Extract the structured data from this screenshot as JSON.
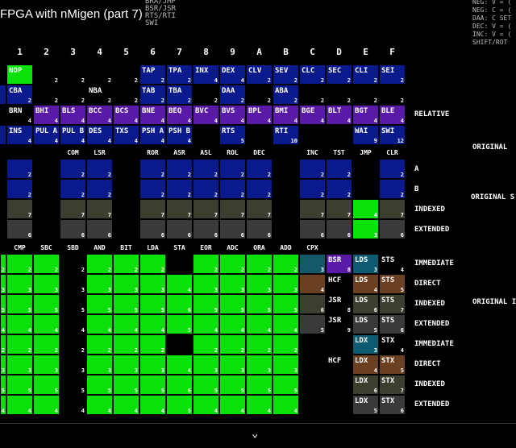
{
  "title": "FPGA with nMigen (part 7)",
  "title_notes": "BRA/JMP\nBSR/JSR\nRTS/RTI\nSWI",
  "side_notes": "NEG: V = (\nNEG: C = (\nDAA: C SET\nDEC: V = (\nINC: V = (\nSHIFT/ROT",
  "col_headers": [
    "1",
    "2",
    "3",
    "4",
    "5",
    "6",
    "7",
    "8",
    "9",
    "A",
    "B",
    "C",
    "D",
    "E",
    "F"
  ],
  "colors": {
    "blue": "#0a1a8c",
    "purple": "#5a1aa8",
    "green": "#0be00b",
    "darkgray": "#1b1b1b",
    "olive": "#3a3f30",
    "gray": "#3a3a3a",
    "teal": "#15586a",
    "brown": "#6a3f22",
    "cyan": "#0e5a70",
    "black": "#000000"
  },
  "top_rows": [
    [
      [
        "",
        "",
        "black"
      ],
      [
        "",
        "2",
        "black"
      ],
      [
        "",
        "2",
        "black"
      ],
      [
        "",
        "2",
        "black"
      ],
      [
        "",
        "2",
        "black"
      ],
      [
        "TAP",
        "2",
        "blue"
      ],
      [
        "TPA",
        "2",
        "blue"
      ],
      [
        "INX",
        "4",
        "blue"
      ],
      [
        "DEX",
        "4",
        "blue"
      ],
      [
        "CLV",
        "2",
        "blue"
      ],
      [
        "SEV",
        "2",
        "blue"
      ],
      [
        "CLC",
        "2",
        "blue"
      ],
      [
        "SEC",
        "2",
        "blue"
      ],
      [
        "CLI",
        "2",
        "blue"
      ],
      [
        "SEI",
        "2",
        "blue"
      ]
    ],
    [
      [
        "CBA",
        "2",
        "blue"
      ],
      [
        "",
        "2",
        "black"
      ],
      [
        "",
        "2",
        "black"
      ],
      [
        "NBA",
        "2",
        "black"
      ],
      [
        "",
        "2",
        "black"
      ],
      [
        "TAB",
        "2",
        "blue"
      ],
      [
        "TBA",
        "2",
        "blue"
      ],
      [
        "",
        "2",
        "black"
      ],
      [
        "DAA",
        "2",
        "blue"
      ],
      [
        "",
        "2",
        "black"
      ],
      [
        "ABA",
        "2",
        "blue"
      ],
      [
        "",
        "2",
        "black"
      ],
      [
        "",
        "2",
        "black"
      ],
      [
        "",
        "2",
        "black"
      ],
      [
        "",
        "2",
        "black"
      ]
    ],
    [
      [
        "BRN",
        "4",
        "black"
      ],
      [
        "BHI",
        "4",
        "purple"
      ],
      [
        "BLS",
        "4",
        "purple"
      ],
      [
        "BCC",
        "4",
        "purple"
      ],
      [
        "BCS",
        "4",
        "purple"
      ],
      [
        "BNE",
        "4",
        "purple"
      ],
      [
        "BEQ",
        "4",
        "purple"
      ],
      [
        "BVC",
        "4",
        "purple"
      ],
      [
        "BVS",
        "4",
        "purple"
      ],
      [
        "BPL",
        "4",
        "purple"
      ],
      [
        "BMI",
        "4",
        "purple"
      ],
      [
        "BGE",
        "4",
        "purple"
      ],
      [
        "BLT",
        "4",
        "purple"
      ],
      [
        "BGT",
        "4",
        "purple"
      ],
      [
        "BLE",
        "4",
        "purple"
      ]
    ],
    [
      [
        "INS",
        "4",
        "blue"
      ],
      [
        "PUL A",
        "4",
        "blue"
      ],
      [
        "PUL B",
        "4",
        "blue"
      ],
      [
        "DES",
        "4",
        "blue"
      ],
      [
        "TXS",
        "4",
        "blue"
      ],
      [
        "PSH A",
        "4",
        "blue"
      ],
      [
        "PSH B",
        "4",
        "blue"
      ],
      [
        "",
        "",
        "black"
      ],
      [
        "RTS",
        "5",
        "blue"
      ],
      [
        "",
        "",
        "black"
      ],
      [
        "RTI",
        "10",
        "blue"
      ],
      [
        "",
        "",
        "black"
      ],
      [
        "",
        "",
        "black"
      ],
      [
        "WAI",
        "9",
        "blue"
      ],
      [
        "SWI",
        "12",
        "blue"
      ]
    ]
  ],
  "nop_label": "NOP",
  "top_side_label": "RELATIVE",
  "mid_mnemonics": [
    "",
    "",
    "COM",
    "LSR",
    "",
    "ROR",
    "ASR",
    "ASL",
    "ROL",
    "DEC",
    "",
    "INC",
    "TST",
    "JMP",
    "CLR"
  ],
  "mid_labels": [
    "A",
    "B",
    "INDEXED",
    "EXTENDED"
  ],
  "mid_rows": [
    [
      [
        "",
        "2",
        "blue"
      ],
      [
        "",
        "",
        "black"
      ],
      [
        "",
        "2",
        "blue"
      ],
      [
        "",
        "2",
        "blue"
      ],
      [
        "",
        "",
        "black"
      ],
      [
        "",
        "2",
        "blue"
      ],
      [
        "",
        "2",
        "blue"
      ],
      [
        "",
        "2",
        "blue"
      ],
      [
        "",
        "2",
        "blue"
      ],
      [
        "",
        "2",
        "blue"
      ],
      [
        "",
        "",
        "black"
      ],
      [
        "",
        "2",
        "blue"
      ],
      [
        "",
        "2",
        "blue"
      ],
      [
        "",
        "",
        "black"
      ],
      [
        "",
        "2",
        "blue"
      ]
    ],
    [
      [
        "",
        "2",
        "blue"
      ],
      [
        "",
        "",
        "black"
      ],
      [
        "",
        "2",
        "blue"
      ],
      [
        "",
        "2",
        "blue"
      ],
      [
        "",
        "",
        "black"
      ],
      [
        "",
        "2",
        "blue"
      ],
      [
        "",
        "2",
        "blue"
      ],
      [
        "",
        "2",
        "blue"
      ],
      [
        "",
        "2",
        "blue"
      ],
      [
        "",
        "2",
        "blue"
      ],
      [
        "",
        "",
        "black"
      ],
      [
        "",
        "2",
        "blue"
      ],
      [
        "",
        "2",
        "blue"
      ],
      [
        "",
        "",
        "black"
      ],
      [
        "",
        "2",
        "blue"
      ]
    ],
    [
      [
        "",
        "7",
        "olive"
      ],
      [
        "",
        "",
        "black"
      ],
      [
        "",
        "7",
        "olive"
      ],
      [
        "",
        "7",
        "olive"
      ],
      [
        "",
        "",
        "black"
      ],
      [
        "",
        "7",
        "olive"
      ],
      [
        "",
        "7",
        "olive"
      ],
      [
        "",
        "7",
        "olive"
      ],
      [
        "",
        "7",
        "olive"
      ],
      [
        "",
        "7",
        "olive"
      ],
      [
        "",
        "",
        "black"
      ],
      [
        "",
        "7",
        "olive"
      ],
      [
        "",
        "7",
        "olive"
      ],
      [
        "",
        "4",
        "green"
      ],
      [
        "",
        "7",
        "olive"
      ]
    ],
    [
      [
        "",
        "6",
        "gray"
      ],
      [
        "",
        "",
        "black"
      ],
      [
        "",
        "6",
        "gray"
      ],
      [
        "",
        "6",
        "gray"
      ],
      [
        "",
        "",
        "black"
      ],
      [
        "",
        "6",
        "gray"
      ],
      [
        "",
        "6",
        "gray"
      ],
      [
        "",
        "6",
        "gray"
      ],
      [
        "",
        "6",
        "gray"
      ],
      [
        "",
        "6",
        "gray"
      ],
      [
        "",
        "",
        "black"
      ],
      [
        "",
        "6",
        "gray"
      ],
      [
        "",
        "6",
        "gray"
      ],
      [
        "",
        "3",
        "green"
      ],
      [
        "",
        "6",
        "gray"
      ]
    ]
  ],
  "orig_labels": [
    "ORIGINAL",
    "ORIGINAL S",
    "ORIGINAL I"
  ],
  "bot_mnemonics": [
    "",
    "CMP",
    "SBC",
    "SBD",
    "AND",
    "BIT",
    "LDA",
    "STA",
    "EOR",
    "ADC",
    "ORA",
    "ADD",
    "CPX",
    "",
    "",
    ""
  ],
  "bot_labels": [
    "IMMEDIATE",
    "DIRECT",
    "INDEXED",
    "EXTENDED",
    "IMMEDIATE",
    "DIRECT",
    "INDEXED",
    "EXTENDED"
  ],
  "bot_cycles": [
    [
      "2",
      "2",
      "2",
      "2",
      "2",
      "2",
      "2",
      "",
      "2",
      "2",
      "2",
      "2"
    ],
    [
      "3",
      "3",
      "3",
      "3",
      "3",
      "3",
      "3",
      "4",
      "3",
      "3",
      "3",
      "3"
    ],
    [
      "5",
      "5",
      "5",
      "5",
      "5",
      "5",
      "5",
      "6",
      "5",
      "5",
      "5",
      "5"
    ],
    [
      "4",
      "4",
      "4",
      "4",
      "4",
      "4",
      "4",
      "5",
      "4",
      "4",
      "4",
      "4"
    ],
    [
      "2",
      "2",
      "2",
      "2",
      "2",
      "2",
      "2",
      "",
      "2",
      "2",
      "2",
      "2"
    ],
    [
      "3",
      "3",
      "3",
      "3",
      "3",
      "3",
      "3",
      "4",
      "3",
      "3",
      "3",
      "3"
    ],
    [
      "5",
      "5",
      "5",
      "5",
      "5",
      "5",
      "5",
      "6",
      "5",
      "5",
      "5",
      "5"
    ],
    [
      "4",
      "4",
      "4",
      "4",
      "4",
      "4",
      "4",
      "5",
      "4",
      "4",
      "4",
      "4"
    ]
  ],
  "bot_black_cells": [
    [
      0,
      3
    ],
    [
      0,
      7
    ],
    [
      1,
      3
    ],
    [
      2,
      3
    ],
    [
      3,
      3
    ],
    [
      4,
      3
    ],
    [
      4,
      7
    ],
    [
      5,
      3
    ],
    [
      6,
      3
    ],
    [
      7,
      3
    ]
  ],
  "bot_right": [
    [
      [
        "",
        "3",
        "teal"
      ],
      [
        "BSR",
        "8",
        "purple"
      ],
      [
        "LDS",
        "3",
        "cyan"
      ],
      [
        "STS",
        "4",
        "black"
      ]
    ],
    [
      [
        "",
        "4",
        "brown"
      ],
      [
        "HCF",
        "",
        "black"
      ],
      [
        "LDS",
        "4",
        "brown"
      ],
      [
        "STS",
        "5",
        "brown"
      ]
    ],
    [
      [
        "",
        "6",
        "olive"
      ],
      [
        "JSR",
        "8",
        "black"
      ],
      [
        "LDS",
        "6",
        "olive"
      ],
      [
        "STS",
        "7",
        "olive"
      ]
    ],
    [
      [
        "",
        "5",
        "gray"
      ],
      [
        "JSR",
        "9",
        "black"
      ],
      [
        "LDS",
        "5",
        "gray"
      ],
      [
        "STS",
        "6",
        "gray"
      ]
    ],
    [
      [
        "",
        "",
        "black"
      ],
      [
        "",
        "",
        "black"
      ],
      [
        "LDX",
        "3",
        "cyan"
      ],
      [
        "STX",
        "4",
        "black"
      ]
    ],
    [
      [
        "",
        "",
        "black"
      ],
      [
        "HCF",
        "",
        "black"
      ],
      [
        "LDX",
        "4",
        "brown"
      ],
      [
        "STX",
        "5",
        "brown"
      ]
    ],
    [
      [
        "",
        "",
        "black"
      ],
      [
        "",
        "",
        "black"
      ],
      [
        "LDX",
        "6",
        "olive"
      ],
      [
        "STX",
        "7",
        "olive"
      ]
    ],
    [
      [
        "",
        "",
        "black"
      ],
      [
        "",
        "",
        "black"
      ],
      [
        "LDX",
        "5",
        "gray"
      ],
      [
        "STX",
        "6",
        "gray"
      ]
    ]
  ]
}
